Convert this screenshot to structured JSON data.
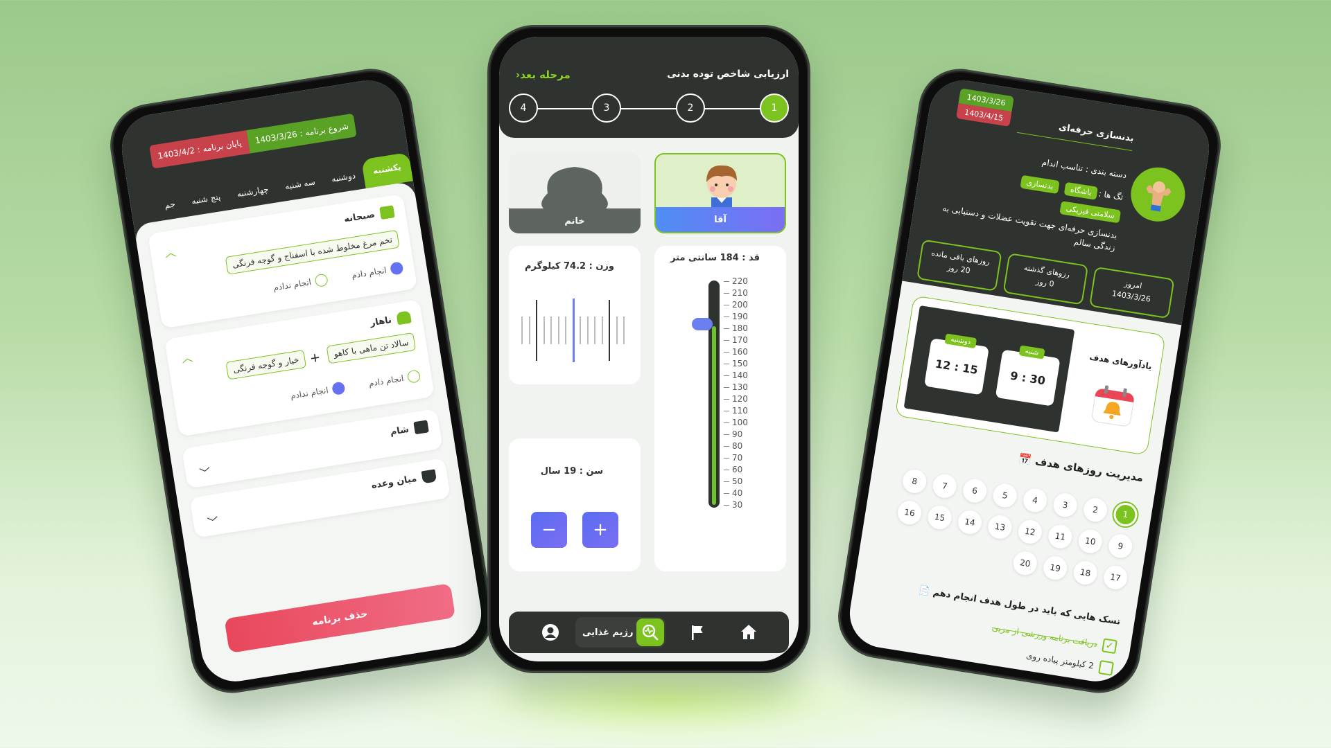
{
  "center": {
    "title": "ارزیابی شاخص توده بدنی",
    "next_label": "مرحله بعد",
    "steps": [
      "1",
      "2",
      "3",
      "4"
    ],
    "active_step": "1",
    "gender": {
      "male": "آقا",
      "female": "خانم",
      "selected": "آقا"
    },
    "weight_label": "وزن : 74.2 کیلوگرم",
    "height_label": "قد : 184 سانتی متر",
    "age_label": "سن : 19 سال",
    "height_scale": [
      "220",
      "210",
      "200",
      "190",
      "180",
      "170",
      "160",
      "150",
      "140",
      "130",
      "120",
      "110",
      "100",
      "90",
      "80",
      "70",
      "60",
      "50",
      "40",
      "30"
    ],
    "height_level": 0.806,
    "minus": "−",
    "plus": "+",
    "nav": {
      "active_label": "رژیم غذایی",
      "items": [
        "home-icon",
        "flag-icon",
        "diet-search-icon",
        "profile-icon"
      ]
    },
    "colors": {
      "accent": "#7cc320",
      "dark": "#2f332f",
      "purple": "#6b7ff1"
    }
  },
  "left": {
    "end_date": "پایان برنامه : 1403/4/2",
    "start_date": "شروع برنامه : 1403/3/26",
    "tabs": [
      "یکشنبه",
      "دوشنبه",
      "سه شنبه",
      "چهارشنبه",
      "پنج شنبه",
      "جم"
    ],
    "active_tab": "یکشنبه",
    "meals": {
      "breakfast": {
        "title": "صبحانه",
        "item": "تخم مرغ مخلوط شده با اسفناج و گوجه فرنگی",
        "done": "انجام دادم",
        "not_done": "انجام ندادم"
      },
      "lunch": {
        "title": "ناهار",
        "item1": "سالاد تن ماهی با کاهو",
        "plus": "+",
        "item2": "خیار و گوجه فرنگی",
        "done": "انجام دادم",
        "not_done": "انجام ندادم"
      },
      "dinner": {
        "title": "شام"
      },
      "snack": {
        "title": "میان وعده"
      }
    },
    "delete_label": "حذف برنامه"
  },
  "right": {
    "start_date": "1403/3/26",
    "end_date": "1403/4/15",
    "title": "بدنسازی حرفه‌ای",
    "category": "دسته بندی : تناسب اندام",
    "tags_label": "تگ ها :",
    "tags": [
      "باشگاه",
      "بدنسازی",
      "سلامتی فیزیکی"
    ],
    "description_1": "بدنسازی حرفه‌ای جهت تقویت عضلات و دستیابی به",
    "description_2": "زندگی سالم",
    "stats": [
      {
        "label": "امروز",
        "value": "1403/3/26"
      },
      {
        "label": "رزوهای گذشته",
        "value": "0 روز"
      },
      {
        "label": "روزهای باقی مانده",
        "value": "20 روز"
      }
    ],
    "reminders_title": "یادآورهای هدف",
    "reminders": [
      {
        "day": "شنبه",
        "time": "9 : 30"
      },
      {
        "day": "دوشنبه",
        "time": "12 : 15"
      }
    ],
    "days_title": "مدیریت روزهای هدف",
    "days_row1": [
      "1",
      "2",
      "3",
      "4",
      "5",
      "6",
      "7",
      "8"
    ],
    "days_row2": [
      "9",
      "10",
      "11",
      "12",
      "13",
      "14",
      "15",
      "16"
    ],
    "days_row3": [
      "17",
      "18",
      "19",
      "20"
    ],
    "active_day": "1",
    "tasks_title": "تسک هایی که باید در طول هدف انجام دهم",
    "tasks": [
      {
        "text": "دریافت برنامه ورزشی از مربی",
        "done": true
      },
      {
        "text": "2 کیلومتر پیاده روی",
        "done": false
      }
    ]
  }
}
